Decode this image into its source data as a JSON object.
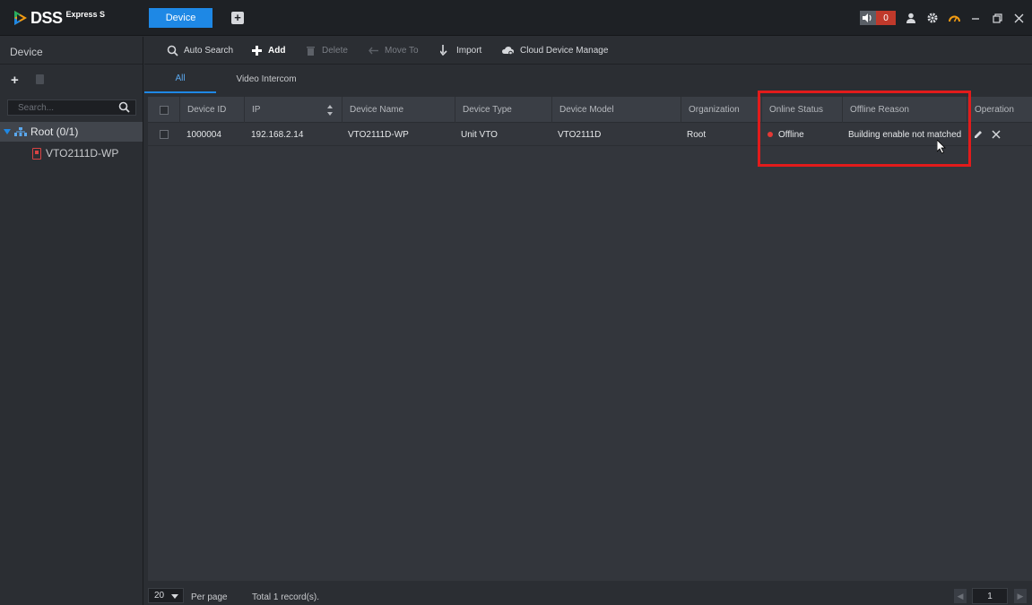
{
  "app": {
    "logo_text": "DSS",
    "logo_sub": "Express S",
    "active_tab": "Device",
    "alarm_count": "0",
    "brand_color": "#1e88e5"
  },
  "sidebar": {
    "title": "Device",
    "search_placeholder": "Search...",
    "tree": {
      "root_label": "Root (0/1)",
      "children": [
        "VTO2111D-WP"
      ]
    }
  },
  "toolbar": {
    "auto_search": "Auto Search",
    "add": "Add",
    "delete": "Delete",
    "move_to": "Move To",
    "import": "Import",
    "cloud_device_manage": "Cloud Device Manage"
  },
  "tabs": [
    "All",
    "Video Intercom"
  ],
  "table": {
    "columns": [
      "Device ID",
      "IP",
      "Device Name",
      "Device Type",
      "Device Model",
      "Organization",
      "Online Status",
      "Offline Reason",
      "Operation"
    ],
    "rows": [
      {
        "device_id": "1000004",
        "ip": "192.168.2.14",
        "device_name": "VTO2111D-WP",
        "device_type": "Unit VTO",
        "device_model": "VTO2111D",
        "organization": "Root",
        "online_status": "Offline",
        "offline_reason": "Building enable not matched"
      }
    ]
  },
  "footer": {
    "per_page_value": "20",
    "per_page_label": "Per page",
    "total": "Total 1 record(s).",
    "page": "1"
  },
  "icons": {
    "status_offline_color": "#e53935",
    "highlight_color": "#e21b1b"
  }
}
